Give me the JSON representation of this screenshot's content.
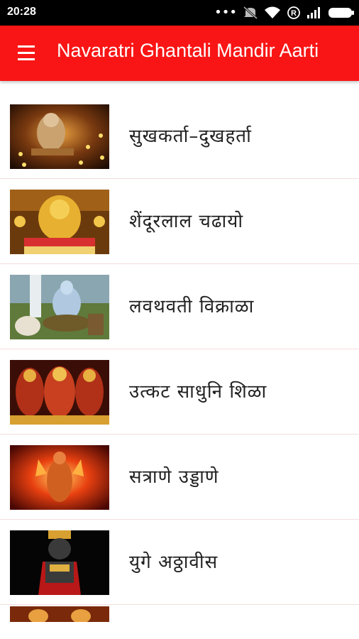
{
  "status_bar": {
    "time": "20:28",
    "icons": [
      "more-dots-icon",
      "mute-icon",
      "wifi-icon",
      "registered-icon",
      "signal-icon",
      "battery-icon"
    ]
  },
  "app_bar": {
    "title": "Navaratri Ghantali Mandir Aarti",
    "menu_icon": "hamburger-menu-icon",
    "color": "#f91515"
  },
  "list": {
    "items": [
      {
        "label": "सुखकर्ता–दुखहर्ता",
        "thumbnail": "ganesha-diya-image"
      },
      {
        "label": "शेंदूरलाल चढायो",
        "thumbnail": "ganesha-golden-idol-image"
      },
      {
        "label": "लवथवती विक्राळा",
        "thumbnail": "shiva-meditation-image"
      },
      {
        "label": "उत्कट साधुनि शिळा",
        "thumbnail": "decorated-idols-image"
      },
      {
        "label": "सत्राणे उड्डाणे",
        "thumbnail": "hanuman-fire-image"
      },
      {
        "label": "युगे अठ्ठावीस",
        "thumbnail": "vitthal-image"
      }
    ]
  }
}
